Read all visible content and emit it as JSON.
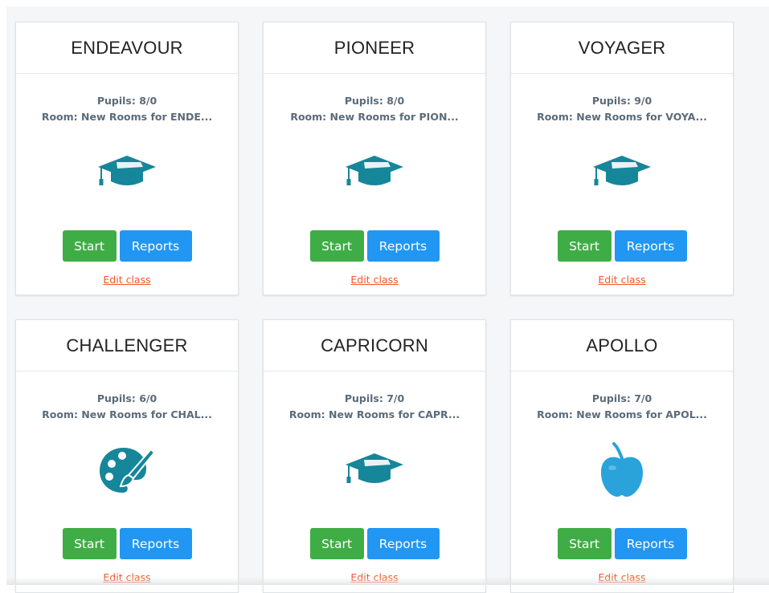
{
  "cards": [
    {
      "title": "ENDEAVOUR",
      "pupils": "Pupils: 8/0",
      "room": "Room: New Rooms for ENDE...",
      "icon": "graduation-cap-icon",
      "start": "Start",
      "reports": "Reports",
      "edit": "Edit class"
    },
    {
      "title": "PIONEER",
      "pupils": "Pupils: 8/0",
      "room": "Room: New Rooms for PION...",
      "icon": "graduation-cap-icon",
      "start": "Start",
      "reports": "Reports",
      "edit": "Edit class"
    },
    {
      "title": "VOYAGER",
      "pupils": "Pupils: 9/0",
      "room": "Room: New Rooms for VOYA...",
      "icon": "graduation-cap-icon",
      "start": "Start",
      "reports": "Reports",
      "edit": "Edit class"
    },
    {
      "title": "CHALLENGER",
      "pupils": "Pupils: 6/0",
      "room": "Room: New Rooms for CHAL...",
      "icon": "palette-icon",
      "start": "Start",
      "reports": "Reports",
      "edit": "Edit class"
    },
    {
      "title": "CAPRICORN",
      "pupils": "Pupils: 7/0",
      "room": "Room: New Rooms for CAPR...",
      "icon": "graduation-cap-icon",
      "start": "Start",
      "reports": "Reports",
      "edit": "Edit class"
    },
    {
      "title": "APOLLO",
      "pupils": "Pupils: 7/0",
      "room": "Room: New Rooms for APOL...",
      "icon": "apple-icon",
      "start": "Start",
      "reports": "Reports",
      "edit": "Edit class"
    }
  ],
  "colors": {
    "icon_teal": "#16869a",
    "apple_blue": "#2aa3da",
    "start_green": "#3fad46",
    "reports_blue": "#2196f3",
    "edit_link_orange": "#f0572a",
    "info_text": "#5b6b79"
  }
}
